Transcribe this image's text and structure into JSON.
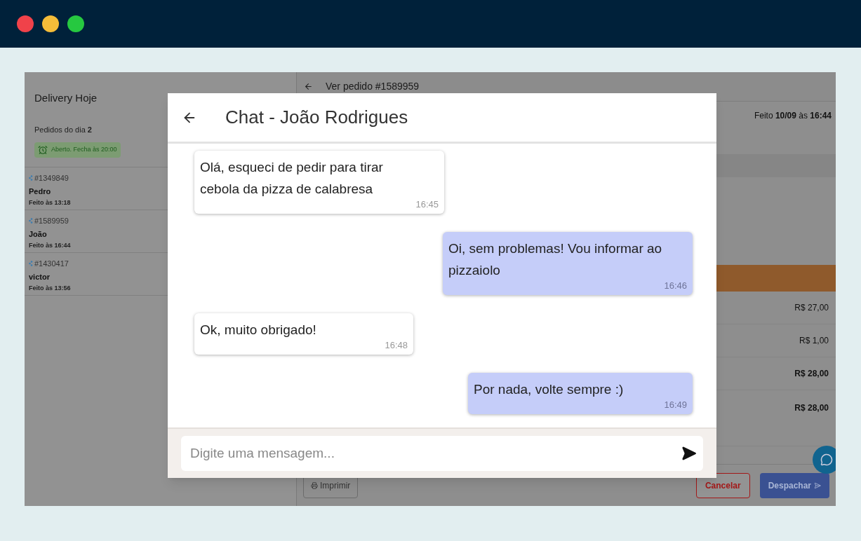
{
  "sidebar": {
    "title": "Delivery Hoje",
    "orders_count": "Pedidos do dia **2**",
    "status": "Aberto. Fecha às 20:00",
    "orders": [
      {
        "number": "#1349849",
        "name": "Pedro",
        "time": "Feito às 13:18"
      },
      {
        "number": "#1589959",
        "name": "João",
        "time": "Feito às 16:44"
      },
      {
        "number": "#1430417",
        "name": "victor",
        "time": "Feito às 13:56"
      }
    ]
  },
  "order": {
    "title": "Ver pedido #1589959",
    "made": "Feito **10/09** às **16:44**",
    "prices": [
      {
        "value": "R$ 27,00",
        "bold": false
      },
      {
        "value": "R$ 1,00",
        "bold": false
      },
      {
        "value": "R$ 28,00",
        "bold": true
      },
      {
        "value": "R$ 28,00",
        "bold": true
      }
    ],
    "buttons": {
      "print": "Imprimir",
      "cancel": "Cancelar",
      "dispatch": "Despachar"
    }
  },
  "chat": {
    "title": "Chat - João Rodrigues",
    "messages": [
      {
        "kind": "received",
        "text": "Olá, esqueci de pedir para tirar cebola da pizza de calabresa",
        "time": "16:45"
      },
      {
        "kind": "sent",
        "text": "Oi, sem problemas! Vou informar ao pizzaiolo",
        "time": "16:46"
      },
      {
        "kind": "received",
        "text": "Ok, muito obrigado!",
        "time": "16:48"
      },
      {
        "kind": "sent",
        "text": "Por nada, volte sempre :)",
        "time": "16:49"
      }
    ],
    "placeholder": "Digite uma mensagem..."
  }
}
